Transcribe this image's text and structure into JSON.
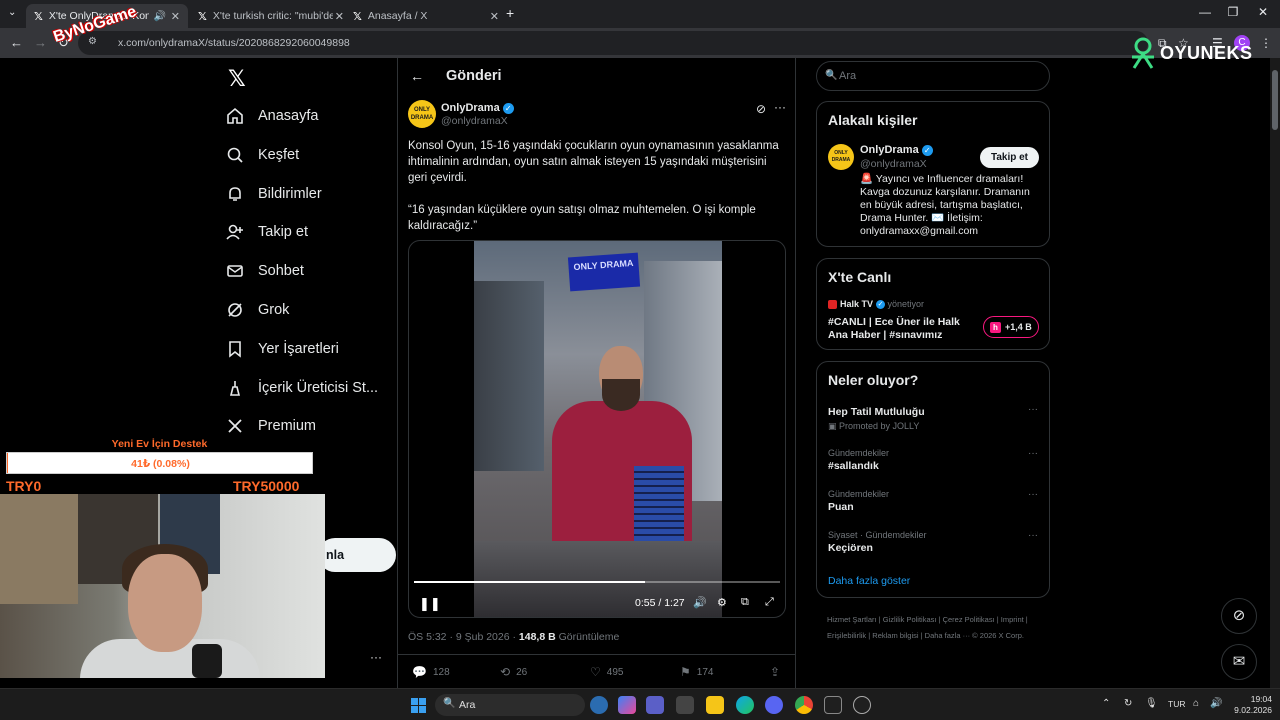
{
  "browser": {
    "tabs": [
      {
        "label": "X'te OnlyDrama: \"Konsol O",
        "active": true
      },
      {
        "label": "X'te turkish critic: \"mubi'de fran",
        "active": false
      },
      {
        "label": "Anasayfa / X",
        "active": false
      }
    ],
    "new_tab": "+",
    "url": "x.com/onlydramaX/status/2020868292060049898",
    "profile_initial": "C"
  },
  "overlays": {
    "bynogame_logo": "ByNoGame",
    "oyuneks_logo": "OYUNEKS",
    "donation": {
      "title": "Yeni Ev İçin Destek",
      "amount": "41₺ (0.08%)",
      "min": "TRY0",
      "max": "TRY50000",
      "fraction": 0.0008
    }
  },
  "leftnav": {
    "items": [
      {
        "label": "Anasayfa",
        "icon": "home-icon"
      },
      {
        "label": "Keşfet",
        "icon": "search-icon"
      },
      {
        "label": "Bildirimler",
        "icon": "bell-icon"
      },
      {
        "label": "Takip et",
        "icon": "follow-icon"
      },
      {
        "label": "Sohbet",
        "icon": "mail-icon"
      },
      {
        "label": "Grok",
        "icon": "grok-icon"
      },
      {
        "label": "Yer İşaretleri",
        "icon": "bookmark-icon"
      },
      {
        "label": "İçerik Üreticisi St...",
        "icon": "creator-studio-icon"
      },
      {
        "label": "Premium",
        "icon": "x-icon"
      }
    ],
    "post_button_partial": "nla"
  },
  "post": {
    "header_title": "Gönderi",
    "author_name": "OnlyDrama",
    "author_handle": "@onlydramaX",
    "avatar_text": "ONLY DRAMA",
    "text_paragraph1": "Konsol Oyun, 15-16 yaşındaki çocukların oyun oynamasının yasaklanma ihtimalinin ardından, oyun satın almak isteyen 15 yaşındaki müşterisini geri çevirdi.",
    "text_paragraph2": "“16 yaşından küçüklere oyun satışı olmaz muhtemelen. O işi komple kaldıracağız.”",
    "video": {
      "sign_text": "ONLY DRAMA",
      "time": "0:55 / 1:27",
      "progress_fraction": 0.632
    },
    "timestamp": "ÖS 5:32 · 9 Şub 2026 · ",
    "views_count": "148,8 B",
    "views_label": " Görüntüleme",
    "actions": {
      "replies": "128",
      "reposts": "26",
      "likes": "495",
      "bookmarks": "174"
    }
  },
  "right": {
    "search_placeholder": "Ara",
    "related": {
      "title": "Alakalı kişiler",
      "name": "OnlyDrama",
      "handle": "@onlydramaX",
      "follow_label": "Takip et",
      "bio": "🚨 Yayıncı ve Influencer dramaları! Kavga dozunuz karşılanır. Dramanın en büyük adresi, tartışma başlatıcı, Drama Hunter. ✉️ İletişim: onlydramaxx@gmail.com"
    },
    "live": {
      "title": "X'te Canlı",
      "channel": "Halk TV",
      "role": " yönetiyor",
      "stream_title": "#CANLI | Ece Üner ile Halk Ana Haber | #sınavımız",
      "listeners": "+1,4 B"
    },
    "trends": {
      "title": "Neler oluyor?",
      "items": [
        {
          "name": "Hep Tatil Mutluluğu",
          "category": "Promoted by JOLLY"
        },
        {
          "category": "Gündemdekiler",
          "name": "#sallandık"
        },
        {
          "category": "Gündemdekiler",
          "name": "Puan"
        },
        {
          "category": "Siyaset · Gündemdekiler",
          "name": "Keçiören"
        }
      ],
      "show_more": "Daha fazla göster"
    },
    "footer": "Hizmet Şartları  |  Gizlilik Politikası  |  Çerez Politikası  |  Imprint  |  Erişilebilirlik  |  Reklam bilgisi  |  Daha fazla ···  © 2026 X Corp."
  },
  "taskbar": {
    "search_placeholder": "Ara",
    "lang": "TUR",
    "time": "19:04",
    "date": "9.02.2026"
  },
  "colors": {
    "accent": "#1d9bf0",
    "background": "#000000",
    "border": "#2f3336",
    "muted_text": "#71767b",
    "donation_orange": "#ff6a2b",
    "live_pink": "#f91880"
  }
}
